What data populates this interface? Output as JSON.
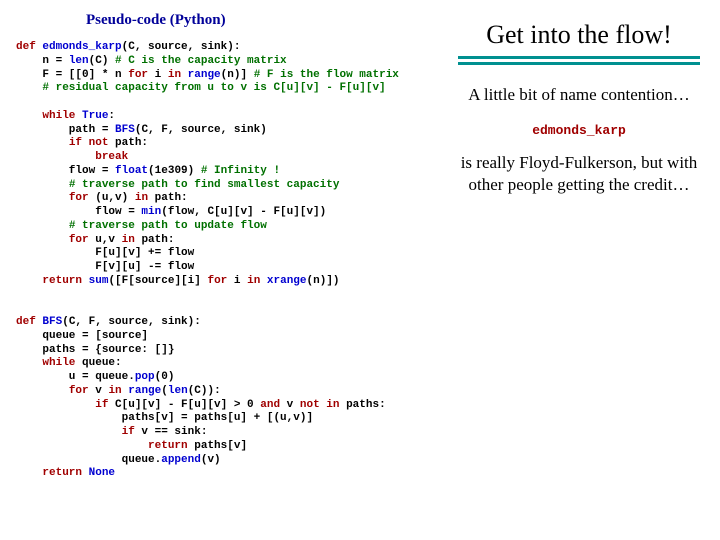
{
  "left": {
    "heading": "Pseudo-code (Python)",
    "code": {
      "l1_kw": "def ",
      "l1_fn": "edmonds_karp",
      "l1_rest": "(C, source, sink):",
      "l2a": "    n = ",
      "l2_fn": "len",
      "l2b": "(C) ",
      "l2_cm": "# C is the capacity matrix",
      "l3a": "    F = [[0] * n ",
      "l3_kw": "for",
      "l3b": " i ",
      "l3_kw2": "in ",
      "l3_fn": "range",
      "l3c": "(n)] ",
      "l3_cm": "# F is the flow matrix",
      "l4_pad": "    ",
      "l4_cm": "# residual capacity from u to v is C[u][v] - F[u][v]",
      "l6_pad": "    ",
      "l6_kw": "while ",
      "l6_tr": "True",
      "l6b": ":",
      "l7a": "        path = ",
      "l7_fn": "BFS",
      "l7b": "(C, F, source, sink)",
      "l8_pad": "        ",
      "l8_kw": "if not",
      "l8b": " path:",
      "l9_pad": "            ",
      "l9_kw": "break",
      "l10a": "        flow = ",
      "l10_fn": "float",
      "l10b": "(1e309) ",
      "l10_cm": "# Infinity !",
      "l11_pad": "        ",
      "l11_cm": "# traverse path to find smallest capacity",
      "l12_pad": "        ",
      "l12_kw": "for",
      "l12a": " (u,v) ",
      "l12_kw2": "in",
      "l12b": " path:",
      "l13a": "            flow = ",
      "l13_fn": "min",
      "l13b": "(flow, C[u][v] - F[u][v])",
      "l14_pad": "        ",
      "l14_cm": "# traverse path to update flow",
      "l15_pad": "        ",
      "l15_kw": "for",
      "l15a": " u,v ",
      "l15_kw2": "in",
      "l15b": " path:",
      "l16": "            F[u][v] += flow",
      "l17": "            F[v][u] -= flow",
      "l18_pad": "    ",
      "l18_kw": "return ",
      "l18_fn": "sum",
      "l18a": "([F[source][i] ",
      "l18_kw2": "for",
      "l18b": " i ",
      "l18_kw3": "in ",
      "l18_fn2": "xrange",
      "l18c": "(n)])",
      "l21_kw": "def ",
      "l21_fn": "BFS",
      "l21a": "(C, F, source, sink):",
      "l22": "    queue = [source]",
      "l23": "    paths = {source: []}",
      "l24_pad": "    ",
      "l24_kw": "while",
      "l24a": " queue:",
      "l25a": "        u = queue.",
      "l25_fn": "pop",
      "l25b": "(0)",
      "l26_pad": "        ",
      "l26_kw": "for",
      "l26a": " v ",
      "l26_kw2": "in ",
      "l26_fn": "range",
      "l26b": "(",
      "l26_fn2": "len",
      "l26c": "(C)):",
      "l27_pad": "            ",
      "l27_kw": "if",
      "l27a": " C[u][v] - F[u][v] > 0 ",
      "l27_kw2": "and",
      "l27b": " v ",
      "l27_kw3": "not in",
      "l27c": " paths:",
      "l28": "                paths[v] = paths[u] + [(u,v)]",
      "l29_pad": "                ",
      "l29_kw": "if",
      "l29a": " v == sink:",
      "l30_pad": "                    ",
      "l30_kw": "return",
      "l30a": " paths[v]",
      "l31a": "                queue.",
      "l31_fn": "append",
      "l31b": "(v)",
      "l32_pad": "    ",
      "l32_kw": "return ",
      "l32_none": "None"
    }
  },
  "right": {
    "title": "Get into the flow!",
    "sub1": "A little bit of name contention…",
    "mono": "edmonds_karp",
    "sub2": "is really Floyd-Fulkerson, but with other people getting the credit…"
  }
}
